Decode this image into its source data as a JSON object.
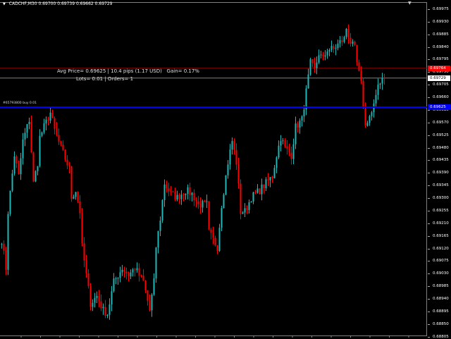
{
  "header": {
    "symbol": "CADCHF,M30",
    "ohlc": "0.69700 0.69739 0.69662 0.69729"
  },
  "info_panel": {
    "line1": "Avg Price= 0.69625 | 10.4 pips (1.17 USD)   Gain= 0.17%",
    "line2": "Lots= 0.01 | Orders= 1"
  },
  "order_label": "#65793800 buy 0.01",
  "price_tags": {
    "ask": {
      "value": "0.69764",
      "price": 0.69764,
      "color": "#ff0000"
    },
    "bid": {
      "value": "0.69729",
      "price": 0.69729,
      "color": "#ffffff"
    },
    "order": {
      "value": "0.69625",
      "price": 0.69625,
      "color": "#0000ff"
    }
  },
  "colors": {
    "bull": "#1fb8b8",
    "bear": "#ff0000",
    "ask_line": "#8b0000",
    "bid_line": "#808080",
    "order_line": "#0000ff"
  },
  "chart_data": {
    "type": "candlestick",
    "title": "CADCHF,M30",
    "ylim": [
      0.6879,
      0.69995
    ],
    "y_ticks": [
      "0.69975",
      "0.69930",
      "0.69885",
      "0.69840",
      "0.69795",
      "0.69750",
      "0.69705",
      "0.69660",
      "0.69615",
      "0.69570",
      "0.69525",
      "0.69480",
      "0.69435",
      "0.69390",
      "0.69345",
      "0.69300",
      "0.69255",
      "0.69210",
      "0.69165",
      "0.69120",
      "0.69075",
      "0.69030",
      "0.68985",
      "0.68940",
      "0.68895",
      "0.68850",
      "0.68805"
    ],
    "close_path": [
      [
        0,
        0.69151
      ],
      [
        2,
        0.6905
      ],
      [
        3,
        0.69252
      ],
      [
        6,
        0.69454
      ],
      [
        8,
        0.69378
      ],
      [
        10,
        0.69504
      ],
      [
        13,
        0.6958
      ],
      [
        15,
        0.69353
      ],
      [
        17,
        0.69428
      ],
      [
        18,
        0.69517
      ],
      [
        20,
        0.69554
      ],
      [
        23,
        0.69605
      ],
      [
        25,
        0.69542
      ],
      [
        28,
        0.69479
      ],
      [
        32,
        0.69403
      ],
      [
        33,
        0.69302
      ],
      [
        35,
        0.69328
      ],
      [
        37,
        0.69252
      ],
      [
        38,
        0.69126
      ],
      [
        40,
        0.69025
      ],
      [
        42,
        0.68924
      ],
      [
        45,
        0.6895
      ],
      [
        48,
        0.68899
      ],
      [
        50,
        0.68887
      ],
      [
        53,
        0.69
      ],
      [
        57,
        0.6905
      ],
      [
        60,
        0.69025
      ],
      [
        63,
        0.6905
      ],
      [
        67,
        0.69
      ],
      [
        70,
        0.68899
      ],
      [
        72,
        0.69
      ],
      [
        73,
        0.69126
      ],
      [
        75,
        0.69227
      ],
      [
        77,
        0.69353
      ],
      [
        80,
        0.69315
      ],
      [
        83,
        0.69302
      ],
      [
        87,
        0.69328
      ],
      [
        90,
        0.69315
      ],
      [
        93,
        0.69277
      ],
      [
        97,
        0.69277
      ],
      [
        98,
        0.69176
      ],
      [
        102,
        0.69126
      ],
      [
        104,
        0.69277
      ],
      [
        107,
        0.69428
      ],
      [
        109,
        0.69504
      ],
      [
        111,
        0.69428
      ],
      [
        113,
        0.69252
      ],
      [
        115,
        0.69252
      ],
      [
        118,
        0.69302
      ],
      [
        122,
        0.69328
      ],
      [
        125,
        0.69353
      ],
      [
        128,
        0.69378
      ],
      [
        130,
        0.69454
      ],
      [
        132,
        0.69517
      ],
      [
        134,
        0.69479
      ],
      [
        137,
        0.69454
      ],
      [
        139,
        0.69554
      ],
      [
        142,
        0.6958
      ],
      [
        143,
        0.6963
      ],
      [
        146,
        0.69781
      ],
      [
        148,
        0.69756
      ],
      [
        150,
        0.69818
      ],
      [
        152,
        0.69794
      ],
      [
        154,
        0.69832
      ],
      [
        157,
        0.69832
      ],
      [
        160,
        0.69857
      ],
      [
        162,
        0.69869
      ],
      [
        163,
        0.69907
      ],
      [
        165,
        0.69857
      ],
      [
        167,
        0.69832
      ],
      [
        168,
        0.69781
      ],
      [
        170,
        0.69706
      ],
      [
        172,
        0.69554
      ],
      [
        173,
        0.6958
      ],
      [
        175,
        0.69605
      ],
      [
        177,
        0.69655
      ],
      [
        178,
        0.69706
      ],
      [
        180,
        0.69731
      ],
      [
        181,
        0.69729
      ]
    ]
  }
}
